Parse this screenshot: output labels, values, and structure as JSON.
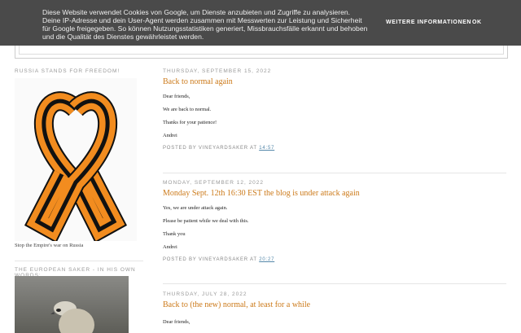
{
  "cookie": {
    "text": "Diese Website verwendet Cookies von Google, um Dienste anzubieten und Zugriffe zu analysieren. Deine IP-Adresse und dein User-Agent werden zusammen mit Messwerten zur Leistung und Sicherheit für Google freigegeben. So können Nutzungsstatistiken generiert, Missbrauchsfälle erkannt und behoben und die Qualität des Dienstes gewährleistet werden.",
    "more_label": "WEITERE INFORMATIONEN",
    "ok_label": "OK"
  },
  "sidebar": {
    "widget1_title": "RUSSIA STANDS FOR FREEDOM!",
    "widget1_caption": "Stop the Empire's war on Russia",
    "widget2_title": "THE EUROPEAN SAKER - IN HIS OWN WORDS:"
  },
  "posts": [
    {
      "date": "THURSDAY, SEPTEMBER 15, 2022",
      "title": "Back to normal again",
      "paragraphs": [
        "Dear friends,",
        "We are back to normal.",
        "Thanks for your patience!",
        "Andrei"
      ],
      "posted_by": "POSTED BY",
      "author": "VINEYARDSAKER",
      "at": "AT",
      "time": "14:57"
    },
    {
      "date": "MONDAY, SEPTEMBER 12, 2022",
      "title": "Monday Sept. 12th 16:30 EST the blog is under attack again",
      "paragraphs": [
        " Yes, we are under attack again.",
        "Please be patient while we deal with this.",
        "Thank you",
        "Andrei"
      ],
      "posted_by": "POSTED BY",
      "author": "VINEYARDSAKER",
      "at": "AT",
      "time": "20:27"
    },
    {
      "date": "THURSDAY, JULY 28, 2022",
      "title": "Back to (the new) normal, at least for a while",
      "paragraphs": [
        " Dear friends,"
      ]
    }
  ],
  "colors": {
    "accent": "#cc7a1a",
    "cookie_bg": "#4a4a4a",
    "ribbon_orange": "#f28c1f",
    "ribbon_black": "#111111"
  }
}
